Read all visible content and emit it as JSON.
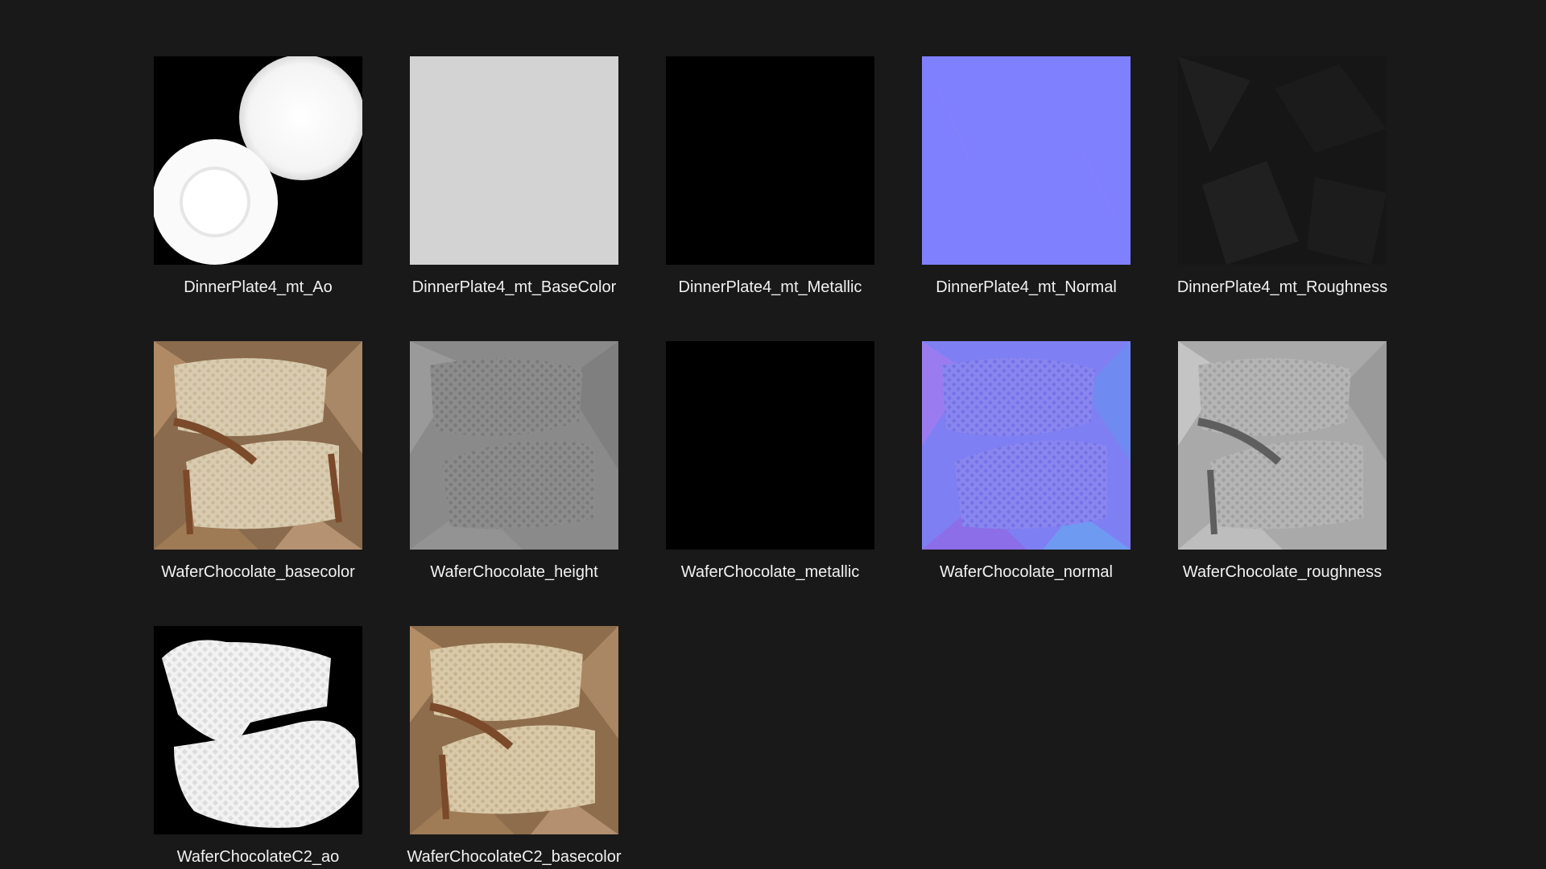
{
  "files": [
    {
      "name": "DinnerPlate4_mt_Ao"
    },
    {
      "name": "DinnerPlate4_mt_BaseColor"
    },
    {
      "name": "DinnerPlate4_mt_Metallic"
    },
    {
      "name": "DinnerPlate4_mt_Normal"
    },
    {
      "name": "DinnerPlate4_mt_Roughness"
    },
    {
      "name": "WaferChocolate_basecolor"
    },
    {
      "name": "WaferChocolate_height"
    },
    {
      "name": "WaferChocolate_metallic"
    },
    {
      "name": "WaferChocolate_normal"
    },
    {
      "name": "WaferChocolate_roughness"
    },
    {
      "name": "WaferChocolateC2_ao"
    },
    {
      "name": "WaferChocolateC2_basecolor"
    }
  ],
  "colors": {
    "background": "#191919",
    "label": "#f2f2f2",
    "normal_map": "#7f80fe",
    "base_gray": "#d2d2d2"
  }
}
